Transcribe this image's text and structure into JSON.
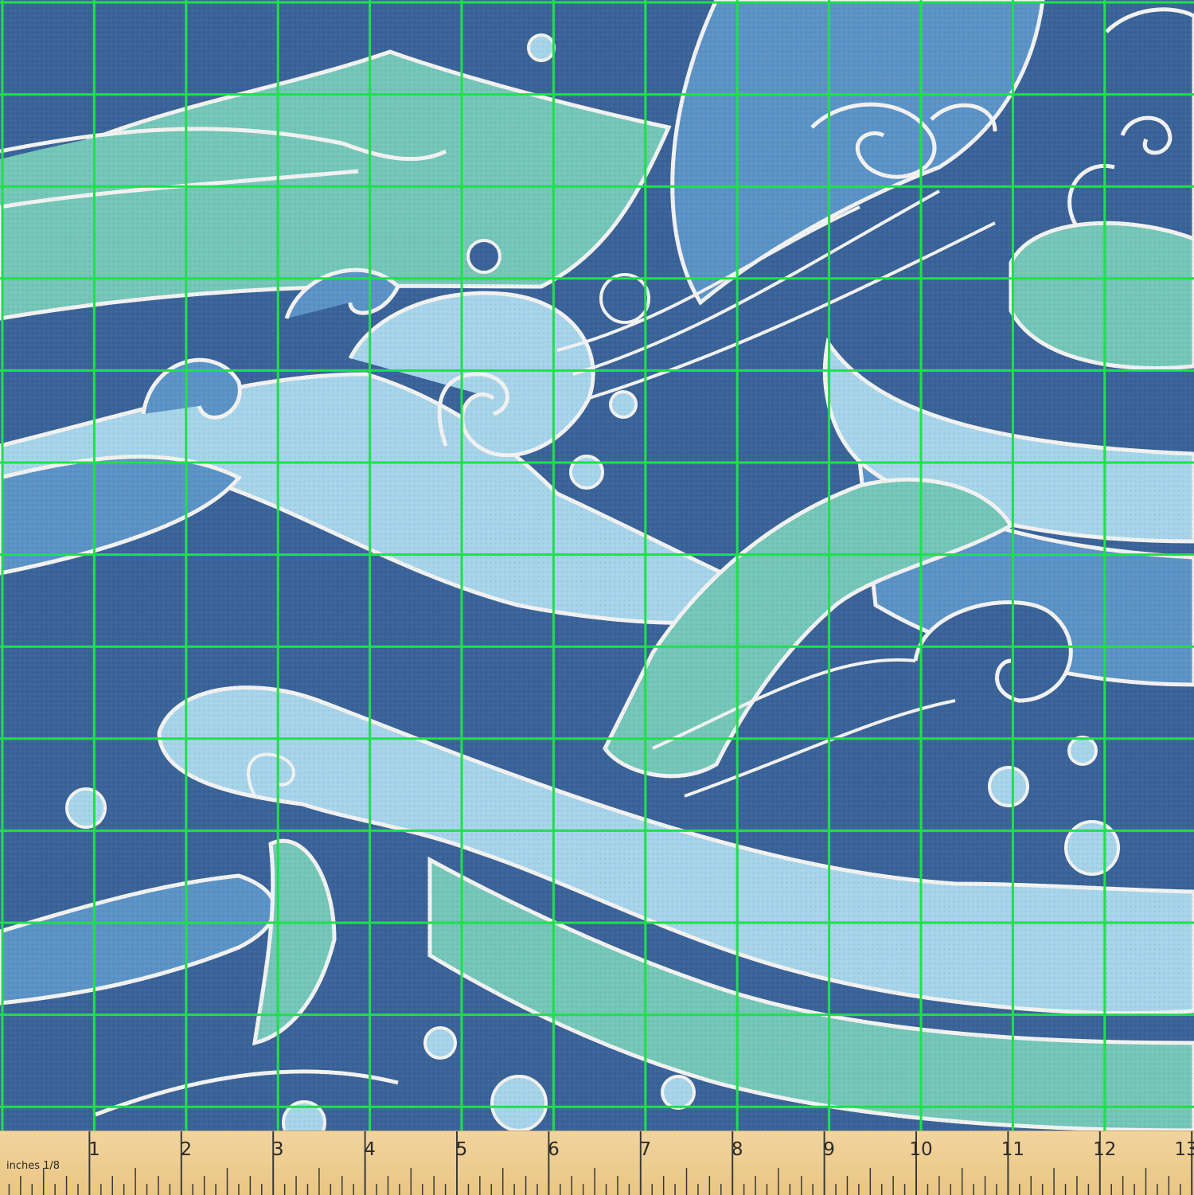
{
  "image": {
    "subject": "fabric-swatch",
    "pattern": "waves-and-swirls",
    "palette": {
      "navy": "#3a6399",
      "mid_blue": "#5b93c7",
      "light_blue": "#a6d4ea",
      "teal": "#74c7b8",
      "outline": "#f2f2f2",
      "grid": "#1fe04a"
    }
  },
  "ruler": {
    "caption": "inches 1/8",
    "inch_labels": [
      "1",
      "2",
      "3",
      "4",
      "5",
      "6",
      "7",
      "8",
      "9",
      "10",
      "11",
      "12",
      "13"
    ]
  }
}
